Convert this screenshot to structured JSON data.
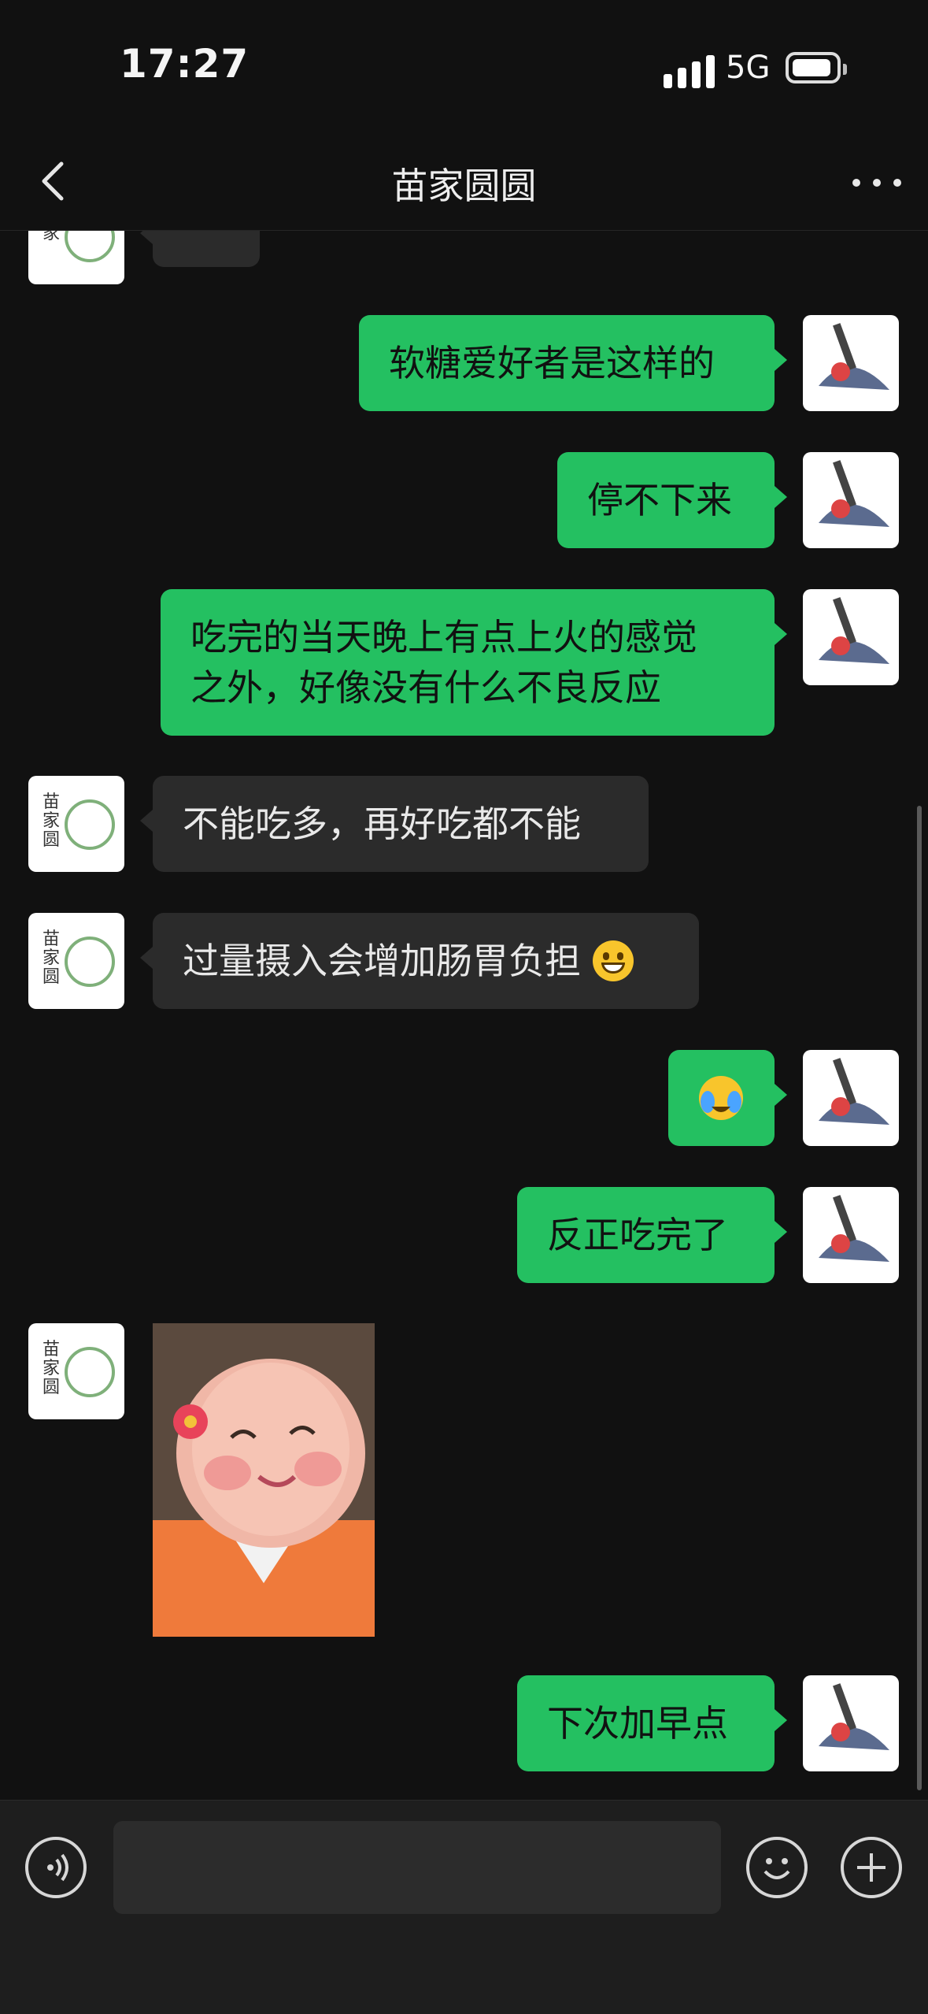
{
  "status_bar": {
    "time": "17:27",
    "network": "5G"
  },
  "nav": {
    "title": "苗家圆圆"
  },
  "messages": [
    {
      "side": "in",
      "type": "emoji",
      "emoji": "😭"
    },
    {
      "side": "out",
      "text": "软糖爱好者是这样的"
    },
    {
      "side": "out",
      "text": "停不下来"
    },
    {
      "side": "out",
      "lines": [
        "吃完的当天晚上有点上火的感觉",
        "之外，好像没有什么不良反应"
      ]
    },
    {
      "side": "in",
      "text": "不能吃多，再好吃都不能"
    },
    {
      "side": "in",
      "text": "过量摄入会增加肠胃负担",
      "emoji": "grinning-emoji"
    },
    {
      "side": "out",
      "type": "emoji",
      "emoji": "😭"
    },
    {
      "side": "out",
      "text": "反正吃完了"
    },
    {
      "side": "in",
      "type": "image",
      "image": "baby-photo"
    },
    {
      "side": "out",
      "text": "下次加早点"
    }
  ],
  "avatars": {
    "contact_logo_text": "苗\n家\n圆\n圆"
  },
  "input_bar": {
    "voice_icon": "voice-icon",
    "emoji_icon": "emoji-icon",
    "plus_icon": "plus-icon",
    "placeholder": ""
  },
  "colors": {
    "outgoing": "#24c061",
    "incoming": "#2b2b2b",
    "background": "#111111"
  }
}
